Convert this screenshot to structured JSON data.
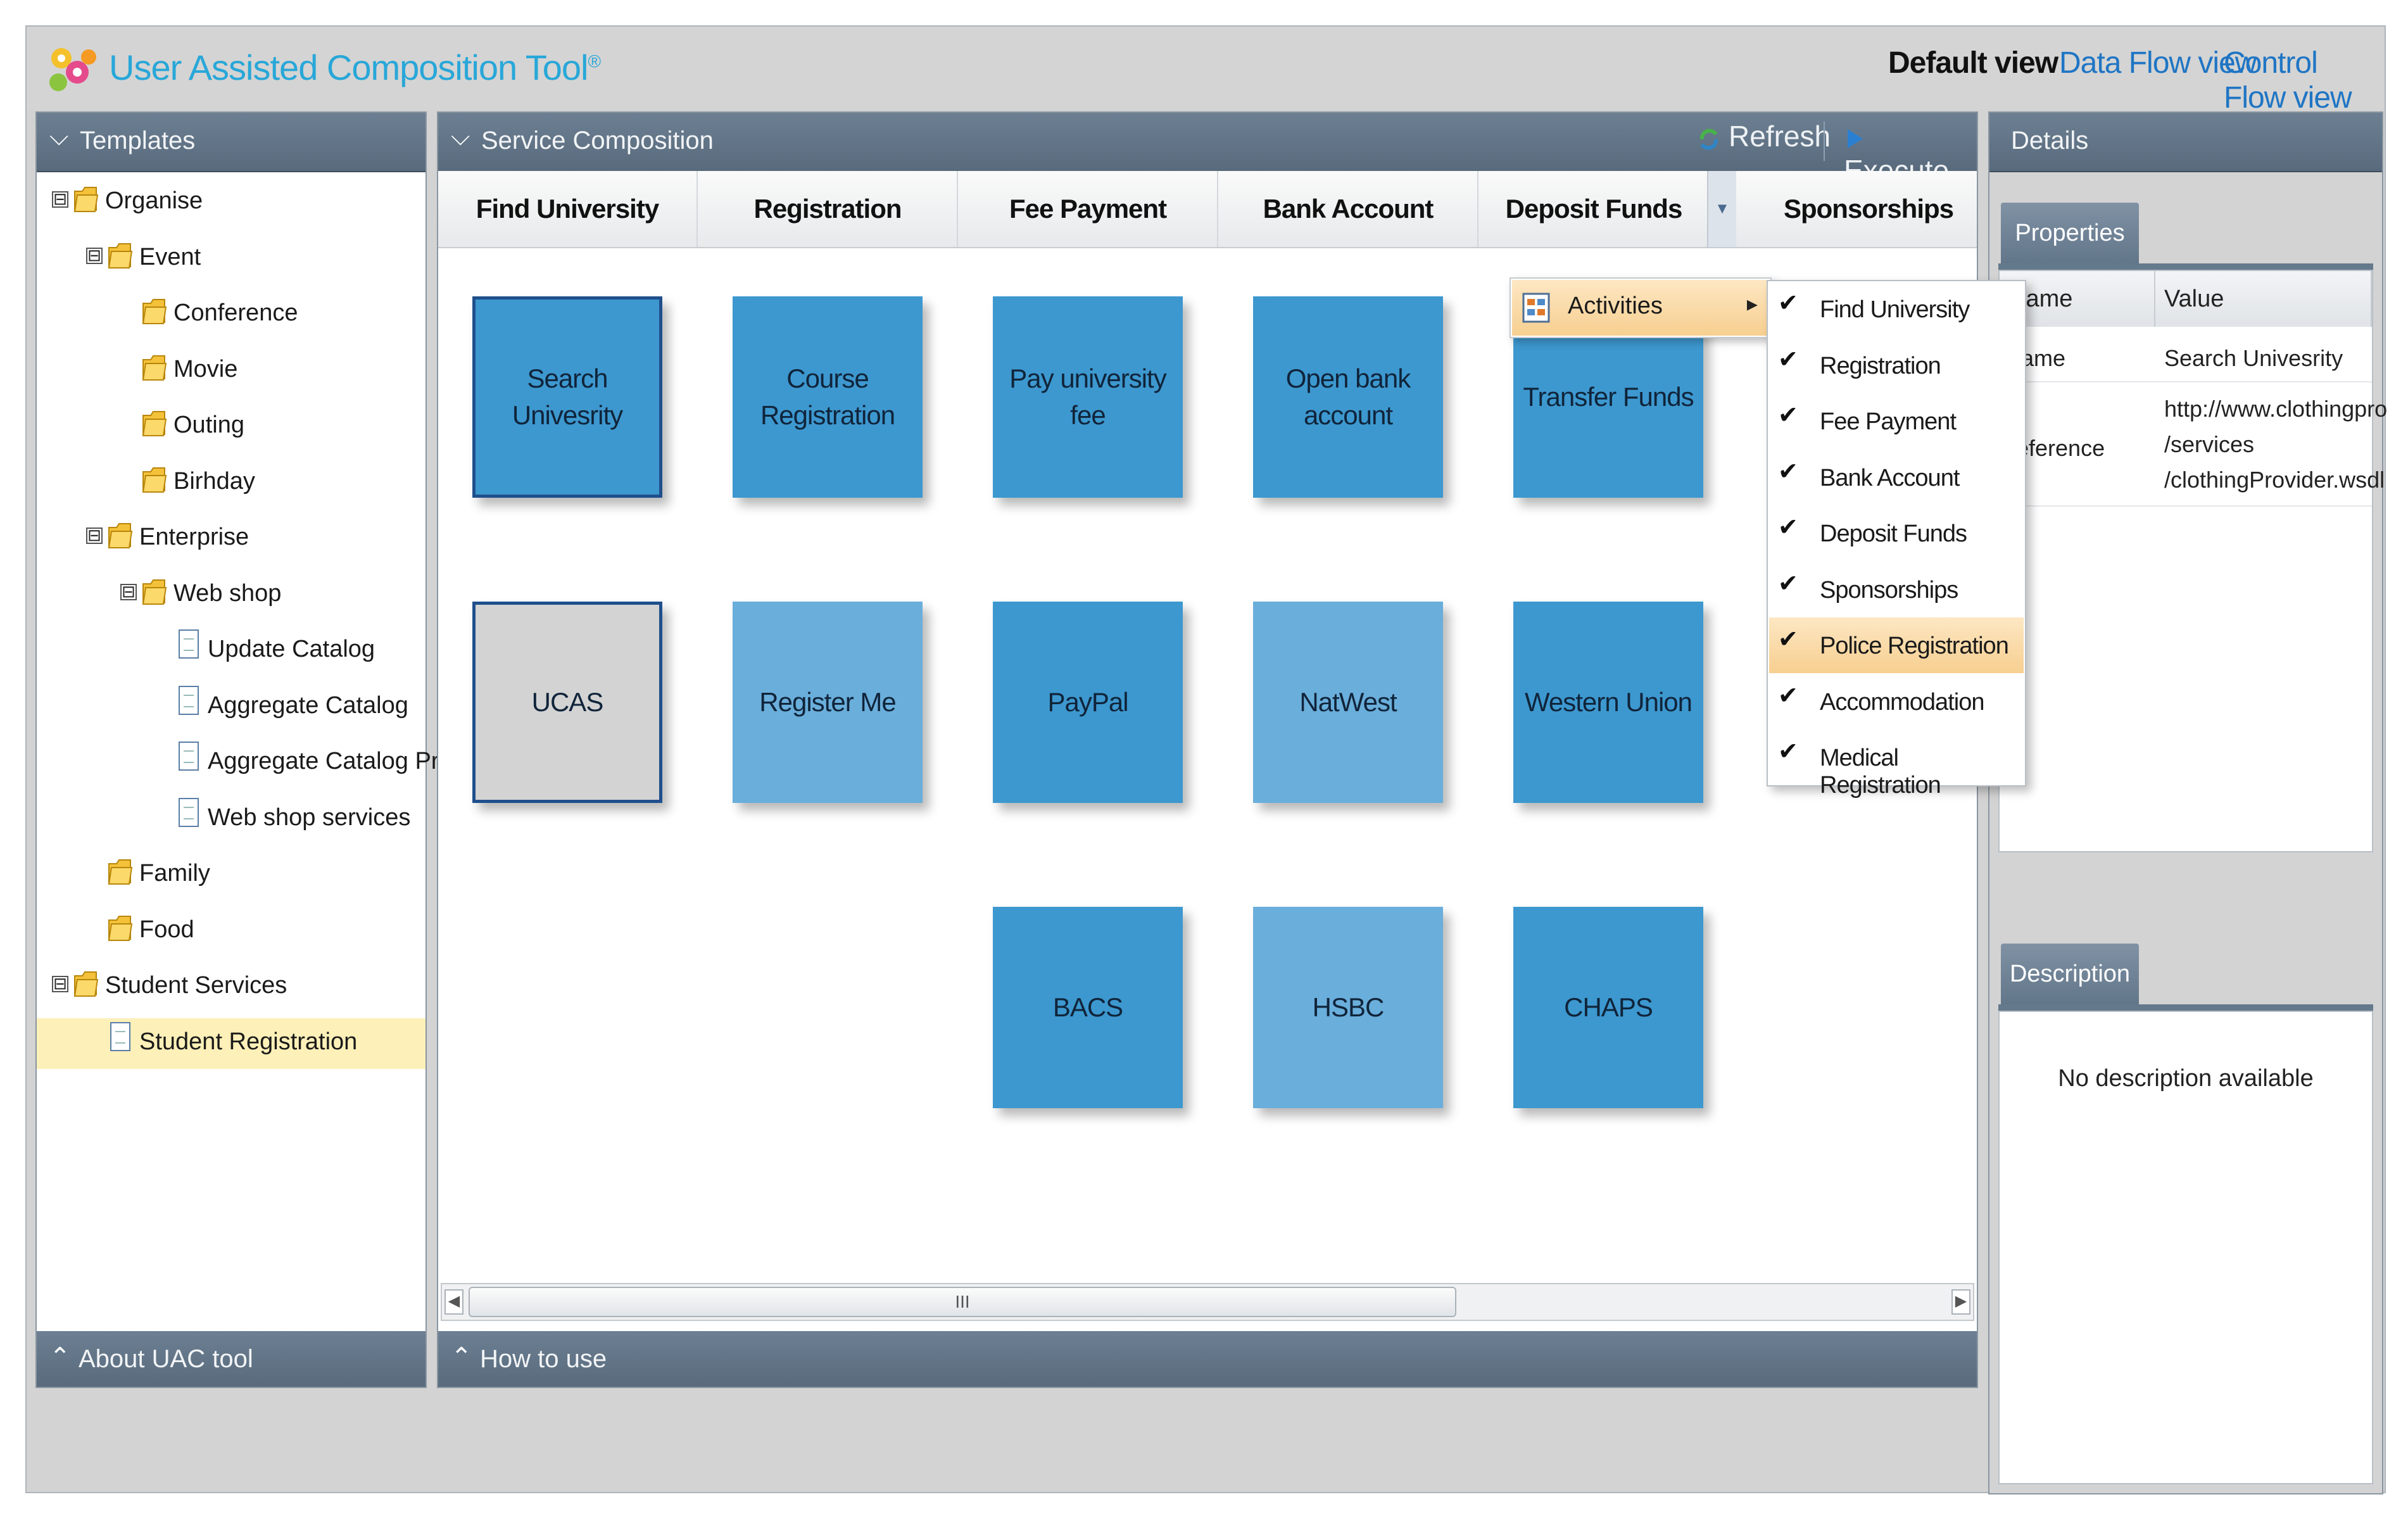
{
  "app": {
    "title": "User Assisted Composition Tool",
    "title_mark": "®",
    "views": {
      "default": "Default view",
      "data_flow": "Data Flow view",
      "control_flow": "Control Flow view"
    }
  },
  "left_panel": {
    "header": "Templates",
    "footer": "About UAC tool",
    "tree": [
      {
        "label": "Organise",
        "type": "folder",
        "level": 0,
        "toggle": "⊟"
      },
      {
        "label": "Event",
        "type": "folder",
        "level": 1,
        "toggle": "⊟"
      },
      {
        "label": "Conference",
        "type": "folder",
        "level": 2
      },
      {
        "label": "Movie",
        "type": "folder",
        "level": 2
      },
      {
        "label": "Outing",
        "type": "folder",
        "level": 2
      },
      {
        "label": "Birhday",
        "type": "folder",
        "level": 2
      },
      {
        "label": "Enterprise",
        "type": "folder",
        "level": 1,
        "toggle": "⊟"
      },
      {
        "label": "Web shop",
        "type": "folder",
        "level": 2,
        "toggle": "⊟"
      },
      {
        "label": "Update Catalog",
        "type": "doc",
        "level": 3
      },
      {
        "label": "Aggregate Catalog",
        "type": "doc",
        "level": 3
      },
      {
        "label": "Aggregate Catalog Produ",
        "type": "doc",
        "level": 3
      },
      {
        "label": "Web shop services",
        "type": "doc",
        "level": 3
      },
      {
        "label": "Family",
        "type": "folder",
        "level": 1
      },
      {
        "label": "Food",
        "type": "folder",
        "level": 1
      },
      {
        "label": "Student Services",
        "type": "folder",
        "level": 0,
        "toggle": "⊟"
      },
      {
        "label": "Student Registration",
        "type": "doc",
        "level": 1,
        "selected": true
      }
    ]
  },
  "center_panel": {
    "header": "Service Composition",
    "refresh": "Refresh",
    "execute": "Execute",
    "footer": "How to use",
    "scroll_grip": "III",
    "columns": [
      "Find University",
      "Registration",
      "Fee Payment",
      "Bank Account",
      "Deposit Funds",
      "Sponsorships"
    ],
    "tiles": [
      {
        "label": "Search Univesrity",
        "style": "dark",
        "selected": true
      },
      {
        "label": "Course Registration",
        "style": "dark"
      },
      {
        "label": "Pay university fee",
        "style": "dark"
      },
      {
        "label": "Open bank account",
        "style": "dark"
      },
      {
        "label": "Transfer Funds",
        "style": "dark"
      },
      {
        "label": "UCAS",
        "style": "grey",
        "selected": true
      },
      {
        "label": "Register Me",
        "style": "light"
      },
      {
        "label": "PayPal",
        "style": "dark"
      },
      {
        "label": "NatWest",
        "style": "light"
      },
      {
        "label": "Western Union",
        "style": "dark"
      },
      {
        "label": "BACS",
        "style": "dark"
      },
      {
        "label": "HSBC",
        "style": "light"
      },
      {
        "label": "CHAPS",
        "style": "dark"
      }
    ]
  },
  "context_menu": {
    "activities_label": "Activities",
    "submenu_arrow": "▸",
    "items": [
      {
        "label": "Find University",
        "checked": "✔"
      },
      {
        "label": "Registration",
        "checked": "✔"
      },
      {
        "label": "Fee Payment",
        "checked": "✔"
      },
      {
        "label": "Bank Account",
        "checked": "✔"
      },
      {
        "label": "Deposit Funds",
        "checked": "✔"
      },
      {
        "label": "Sponsorships",
        "checked": "✔"
      },
      {
        "label": "Police Registration",
        "checked": "✔",
        "highlighted": true
      },
      {
        "label": "Accommodation",
        "checked": "✔"
      },
      {
        "label": "Medical Registration",
        "checked": "✔"
      }
    ]
  },
  "right_panel": {
    "header": "Details",
    "properties_tab": "Properties",
    "description_tab": "Description",
    "table_headers": {
      "name": "Name",
      "value": "Value"
    },
    "rows": [
      {
        "name": "name",
        "value": "Search Univesrity"
      },
      {
        "name": "reference",
        "value_lines": [
          "http://www.clothingpro",
          "/services",
          "/clothingProvider.wsdl"
        ]
      }
    ],
    "description_text": "No description available"
  },
  "colors": {
    "accent": "#28a7d8",
    "header_bar": "#62768a",
    "tile_dark": "#3d98cf",
    "tile_light": "#6aaedb",
    "highlight": "#f7cf90"
  }
}
